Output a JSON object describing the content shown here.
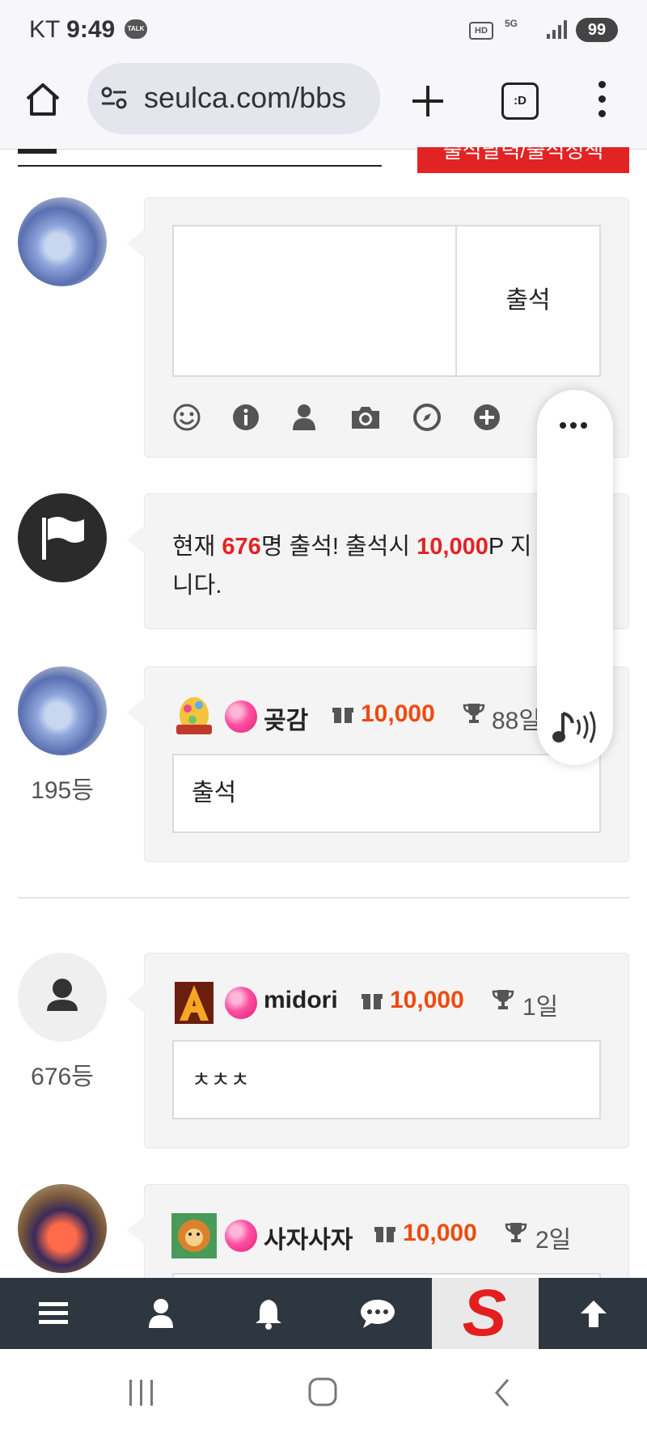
{
  "status_bar": {
    "carrier": "KT",
    "time": "9:49",
    "talk_badge": "TALK",
    "hd": "HD",
    "net": "5G",
    "battery": "99"
  },
  "browser": {
    "url": "seulca.com/bbs",
    "tab_label": ":D",
    "icons": [
      "home-icon",
      "tune-icon",
      "plus-icon",
      "tab-switcher-icon",
      "more-vert-icon"
    ]
  },
  "header": {
    "red_button_label": "출석달력/출석정책"
  },
  "composer": {
    "submit_label": "출석",
    "textarea_value": "",
    "tool_icons": [
      "smile-icon",
      "info-icon",
      "user-icon",
      "camera-icon",
      "compass-icon",
      "plus-circle-icon"
    ]
  },
  "notice": {
    "prefix": "현재 ",
    "count": "676",
    "mid": "명 출석! 출석시 ",
    "points": "10,000",
    "suffix": "P 지",
    "line2": "니다."
  },
  "entries": [
    {
      "rank": "195등",
      "nickname": "곶감",
      "points": "10,000",
      "days": "88일",
      "message": "출석"
    },
    {
      "rank": "676등",
      "nickname": "midori",
      "points": "10,000",
      "days": "1일",
      "message": "ㅊㅊㅊ"
    },
    {
      "rank": "",
      "nickname": "사자사자",
      "points": "10,000",
      "days": "2일",
      "message": ""
    }
  ],
  "floating_panel": {
    "icons": [
      "more-horiz-icon",
      "read-aloud-icon"
    ]
  },
  "app_nav": {
    "items": [
      "menu-icon",
      "user-icon",
      "bell-icon",
      "chat-icon",
      "site-logo",
      "arrow-up-icon"
    ],
    "logo_letter": "S"
  },
  "colors": {
    "accent_red": "#e32323",
    "points_orange": "#ef4a0f",
    "nav_bg": "#2e3740"
  }
}
